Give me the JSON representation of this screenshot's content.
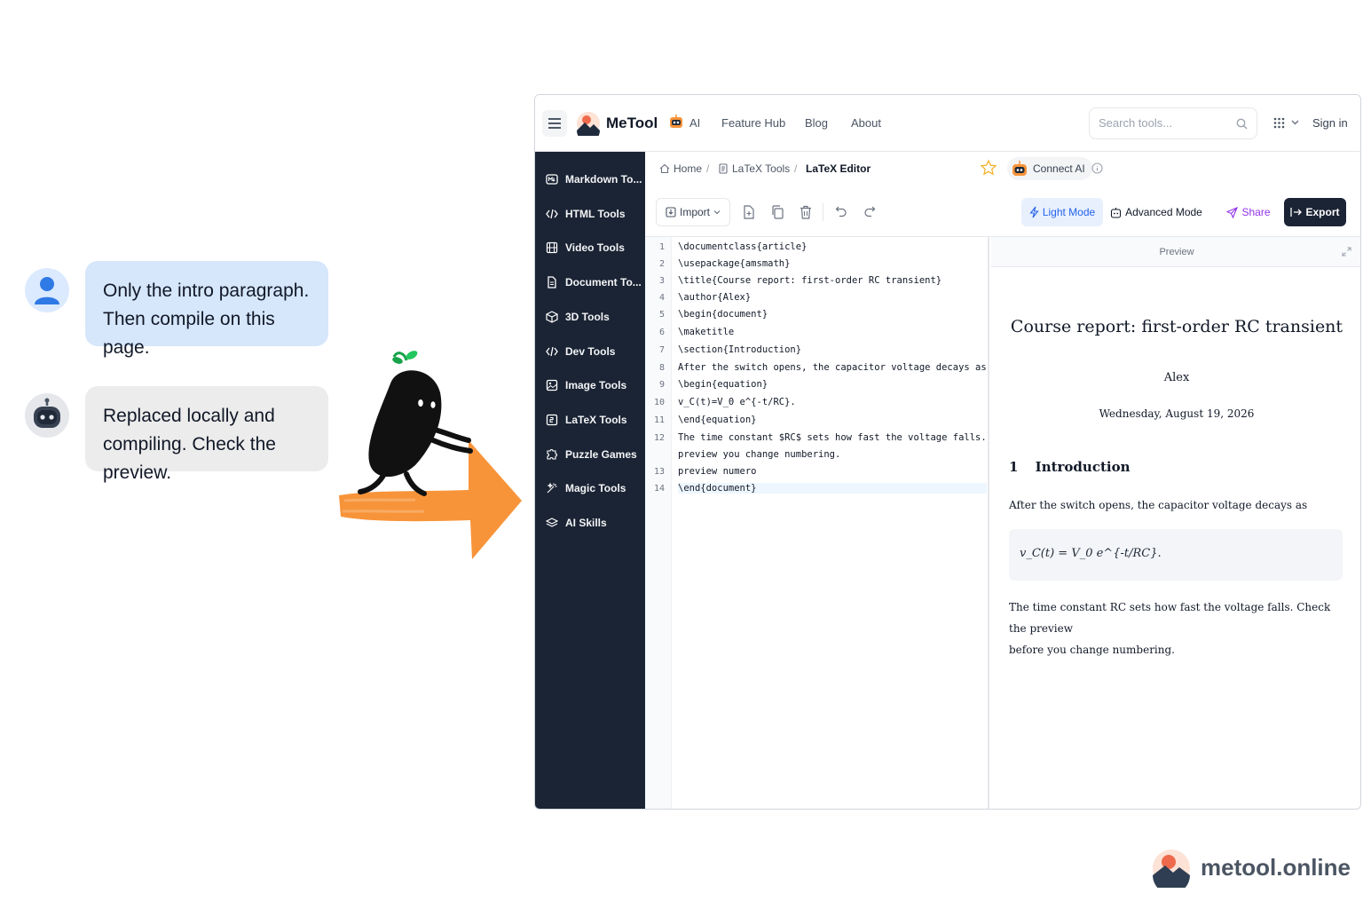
{
  "chat": {
    "user_message_line1": "Only the intro paragraph.",
    "user_message_line2": "Then compile on this page.",
    "bot_message_line1": "Replaced locally and",
    "bot_message_line2": "compiling. Check the preview."
  },
  "colors": {
    "accent_orange": "#f7943a",
    "sidebar_bg": "#1b2434",
    "link_blue": "#2563eb",
    "share_purple": "#9333ea"
  },
  "topnav": {
    "brand": "MeTool",
    "links": [
      "AI",
      "Feature Hub",
      "Blog",
      "About"
    ],
    "search_placeholder": "Search tools...",
    "sign_in": "Sign in"
  },
  "sidebar": {
    "items": [
      {
        "label": "Markdown To...",
        "icon": "markdown-icon"
      },
      {
        "label": "HTML Tools",
        "icon": "code-icon"
      },
      {
        "label": "Video Tools",
        "icon": "film-icon"
      },
      {
        "label": "Document To...",
        "icon": "document-icon"
      },
      {
        "label": "3D Tools",
        "icon": "cube-icon"
      },
      {
        "label": "Dev Tools",
        "icon": "code-icon"
      },
      {
        "label": "Image Tools",
        "icon": "image-icon"
      },
      {
        "label": "LaTeX Tools",
        "icon": "latex-icon"
      },
      {
        "label": "Puzzle Games",
        "icon": "puzzle-icon"
      },
      {
        "label": "Magic Tools",
        "icon": "sparkle-icon"
      },
      {
        "label": "AI Skills",
        "icon": "layers-icon"
      }
    ]
  },
  "breadcrumb": {
    "home": "Home",
    "category": "LaTeX Tools",
    "current": "LaTeX Editor",
    "connect_ai": "Connect AI"
  },
  "toolbar": {
    "import": "Import",
    "light_mode": "Light Mode",
    "advanced_mode": "Advanced Mode",
    "share": "Share",
    "export": "Export"
  },
  "editor": {
    "line_numbers": [
      "1",
      "2",
      "3",
      "4",
      "5",
      "6",
      "7",
      "8",
      "9",
      "10",
      "11",
      "12",
      "",
      "13",
      "14"
    ],
    "lines": [
      "\\documentclass{article}",
      "\\usepackage{amsmath}",
      "\\title{Course report: first-order RC transient}",
      "\\author{Alex}",
      "\\begin{document}",
      "\\maketitle",
      "\\section{Introduction}",
      "After the switch opens, the capacitor voltage decays as",
      "\\begin{equation}",
      "v_C(t)=V_0 e^{-t/RC}.",
      "\\end{equation}",
      "The time constant $RC$ sets how fast the voltage falls. Check:",
      "preview you change numbering.",
      "preview numero",
      "\\end{document}"
    ]
  },
  "preview": {
    "label": "Preview",
    "title": "Course report: first-order RC transient",
    "author": "Alex",
    "date": "Wednesday, August 19, 2026",
    "section_number": "1",
    "section_title": "Introduction",
    "para1": "After the switch opens, the capacitor voltage decays as",
    "equation": "v_C(t) = V_0 e^{-t/RC}.",
    "para2_line1": "The time constant RC sets how fast the voltage falls. Check the preview",
    "para2_line2": "before you change numbering."
  },
  "watermark": {
    "text": "metool.online"
  }
}
